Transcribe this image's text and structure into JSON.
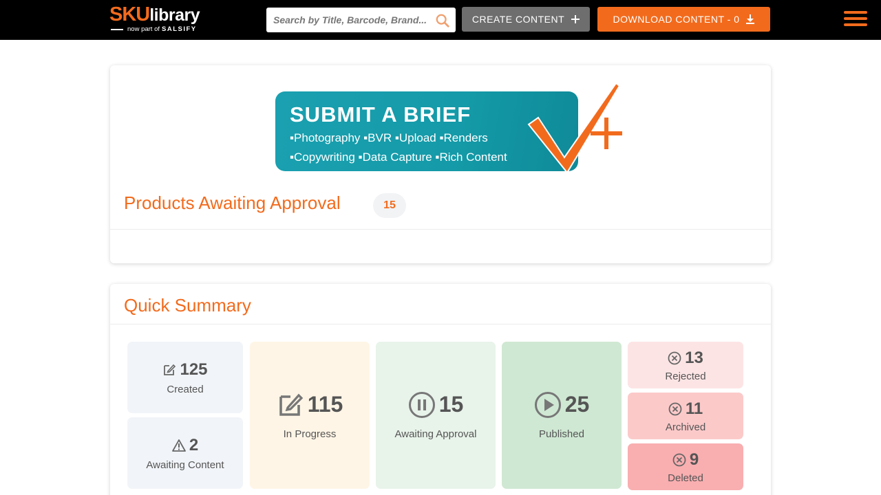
{
  "header": {
    "logo": {
      "sku": "SKU",
      "library": "library",
      "subtitle": "now part of",
      "brand": "SALSIFY"
    },
    "search": {
      "placeholder": "Search by Title, Barcode, Brand...",
      "value": ""
    },
    "create_button": "CREATE CONTENT",
    "download_button": "DOWNLOAD CONTENT - 0",
    "colors": {
      "background": "#000000",
      "accent": "#f26b1d",
      "create_bg": "#6e6e6e"
    }
  },
  "banner": {
    "title": "SUBMIT A BRIEF",
    "line1": "▪Photography  ▪BVR  ▪Upload  ▪Renders",
    "line2": "▪Copywriting  ▪Data Capture  ▪Rich Content"
  },
  "approval": {
    "title": "Products Awaiting Approval",
    "count": "15"
  },
  "summary": {
    "title": "Quick Summary",
    "tiles": {
      "created": {
        "value": "125",
        "label": "Created",
        "icon": "edit-icon"
      },
      "awaiting_content": {
        "value": "2",
        "label": "Awaiting Content",
        "icon": "warning-icon"
      },
      "in_progress": {
        "value": "115",
        "label": "In Progress",
        "icon": "edit-icon"
      },
      "awaiting_approval": {
        "value": "15",
        "label": "Awaiting Approval",
        "icon": "pause-icon"
      },
      "published": {
        "value": "25",
        "label": "Published",
        "icon": "play-icon"
      },
      "rejected": {
        "value": "13",
        "label": "Rejected",
        "icon": "x-circle-icon"
      },
      "archived": {
        "value": "11",
        "label": "Archived",
        "icon": "x-circle-icon"
      },
      "deleted": {
        "value": "9",
        "label": "Deleted",
        "icon": "x-circle-icon"
      }
    }
  }
}
